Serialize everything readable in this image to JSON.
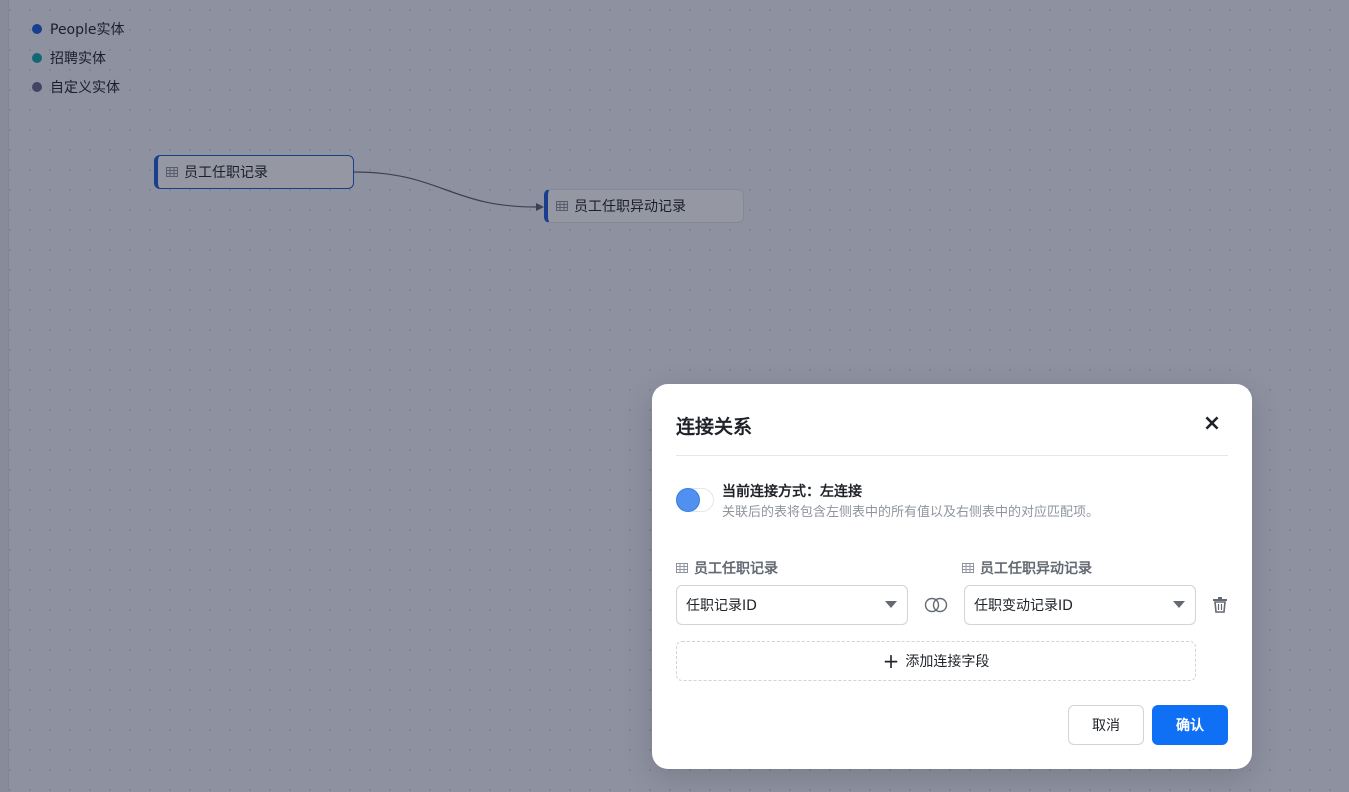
{
  "legend": {
    "items": [
      {
        "label": "People实体",
        "color": "#1a5fd8"
      },
      {
        "label": "招聘实体",
        "color": "#13a8a8"
      },
      {
        "label": "自定义实体",
        "color": "#646a8a"
      }
    ]
  },
  "graph": {
    "node_left": {
      "label": "员工任职记录",
      "icon": "table-icon"
    },
    "node_right": {
      "label": "员工任职异动记录",
      "icon": "table-icon"
    }
  },
  "dialog": {
    "title": "连接关系",
    "close_label": "×",
    "join_mode_title": "当前连接方式：左连接",
    "join_mode_desc": "关联后的表将包含左侧表中的所有值以及右侧表中的对应匹配项。",
    "left_table_label": "员工任职记录",
    "right_table_label": "员工任职异动记录",
    "left_field_value": "任职记录ID",
    "right_field_value": "任职变动记录ID",
    "add_field_label": "添加连接字段",
    "cancel_label": "取消",
    "confirm_label": "确认"
  },
  "colors": {
    "primary": "#0f6ff5",
    "node_accent": "#1a5fd8"
  }
}
